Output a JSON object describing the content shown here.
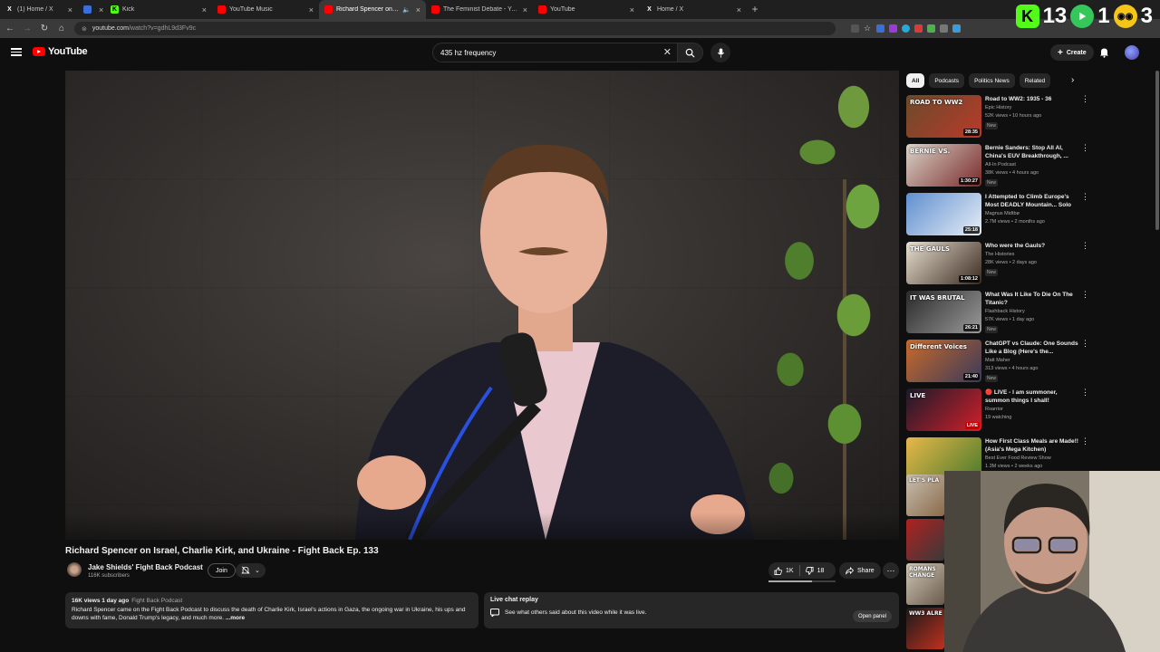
{
  "browser": {
    "tabs": [
      {
        "title": "(1) Home / X",
        "favicon": "x-icon",
        "active": false
      },
      {
        "title": "",
        "favicon": "mail-icon",
        "active": false
      },
      {
        "title": "Kick",
        "favicon": "kick-icon",
        "active": false
      },
      {
        "title": "YouTube Music",
        "favicon": "youtube-music-icon",
        "active": false
      },
      {
        "title": "Richard Spencer on Israel, C",
        "favicon": "youtube-icon",
        "active": true
      },
      {
        "title": "The Feminist Debate - YouTube",
        "favicon": "youtube-icon",
        "active": false
      },
      {
        "title": "YouTube",
        "favicon": "youtube-icon",
        "active": false
      },
      {
        "title": "Home / X",
        "favicon": "x-icon",
        "active": false
      }
    ],
    "url_host": "youtube.com",
    "url_path": "/watch?v=gdhL9d3Fv9c",
    "overlay": {
      "k": "K",
      "n1": "13",
      "n2": "1",
      "n3": "3"
    }
  },
  "youtube": {
    "logo_text": "YouTube",
    "search_value": "435 hz frequency",
    "create_label": "Create"
  },
  "video": {
    "title": "Richard Spencer on Israel, Charlie Kirk, and Ukraine - Fight Back Ep. 133",
    "channel": "Jake Shields' Fight Back Podcast",
    "subscribers": "116K subscribers",
    "join_label": "Join",
    "likes": "1K",
    "dislikes": "18",
    "share_label": "Share",
    "description": {
      "meta": "16K views  1 day ago",
      "tag": "Fight Back Podcast",
      "text": "Richard Spencer came on the Fight Back Podcast to discuss the death of Charlie Kirk, Israel's actions in Gaza, the ongoing war in Ukraine, his ups and downs with fame, Donald Trump's legacy, and much more. ",
      "more": "...more"
    },
    "live_replay": {
      "title": "Live chat replay",
      "text": "See what others said about this video while it was live.",
      "button": "Open panel"
    }
  },
  "sidebar": {
    "chips": [
      "All",
      "Podcasts",
      "Politics News",
      "Related"
    ],
    "recommendations": [
      {
        "title": "Road to WW2: 1935 - 36",
        "channel": "Epic History",
        "meta": "52K views • 10 hours ago",
        "badge": "New",
        "duration": "28:35",
        "thumb_text": "ROAD TO WW2",
        "colors": [
          "#6b4a2a",
          "#b83a2a"
        ]
      },
      {
        "title": "Bernie Sanders: Stop All AI, China's EUV Breakthrough, ...",
        "channel": "All-In Podcast",
        "meta": "38K views • 4 hours ago",
        "badge": "New",
        "duration": "1:30:27",
        "thumb_text": "BERNIE VS.",
        "colors": [
          "#d9d3c8",
          "#7a2a2a"
        ]
      },
      {
        "title": "I Attempted to Climb Europe's Most DEADLY Mountain... Solo",
        "channel": "Magnus Midtbø",
        "meta": "2.7M views • 2 months ago",
        "badge": "",
        "duration": "25:18",
        "thumb_text": "",
        "colors": [
          "#5f8fd0",
          "#e8eef5"
        ]
      },
      {
        "title": "Who were the Gauls?",
        "channel": "The Histories",
        "meta": "28K views • 2 days ago",
        "badge": "New",
        "duration": "1:08:12",
        "thumb_text": "THE GAULS",
        "colors": [
          "#e8e0d0",
          "#3a2a20"
        ]
      },
      {
        "title": "What Was It Like To Die On The Titanic?",
        "channel": "Flashback History",
        "meta": "57K views • 1 day ago",
        "badge": "New",
        "duration": "26:21",
        "thumb_text": "IT WAS BRUTAL",
        "colors": [
          "#2a2a2a",
          "#9a9a9a"
        ]
      },
      {
        "title": "ChatGPT vs Claude: One Sounds Like a Blog (Here's the...",
        "channel": "Matt Maher",
        "meta": "313 views • 4 hours ago",
        "badge": "New",
        "duration": "21:40",
        "thumb_text": "Different Voices",
        "colors": [
          "#c86a2a",
          "#3a3a5a"
        ]
      },
      {
        "title": "🔴 LIVE - I am summoner, summon things I shall!",
        "channel": "Roarrior",
        "meta": "19 watching",
        "badge": "",
        "duration": "LIVE",
        "thumb_text": "LIVE",
        "colors": [
          "#1a1a2a",
          "#d0202a"
        ]
      },
      {
        "title": "How First Class Meals are Made!! (Asia's Mega Kitchen)",
        "channel": "Best Ever Food Review Show",
        "meta": "1.3M views • 2 weeks ago",
        "badge": "",
        "duration": "22:09",
        "thumb_text": "",
        "colors": [
          "#e8b84a",
          "#4a7a2a"
        ]
      }
    ],
    "lower_thumbs": [
      {
        "text": "LET'S PLA",
        "colors": [
          "#c8c0b0",
          "#8a6a4a"
        ]
      },
      {
        "text": "",
        "colors": [
          "#b02020",
          "#3a3a3a"
        ]
      },
      {
        "text": "ROMANS CHANGE",
        "colors": [
          "#d0c8b8",
          "#6a5a4a"
        ]
      },
      {
        "text": "WW3 ALRE",
        "colors": [
          "#1a1a1a",
          "#c03020"
        ]
      }
    ]
  }
}
